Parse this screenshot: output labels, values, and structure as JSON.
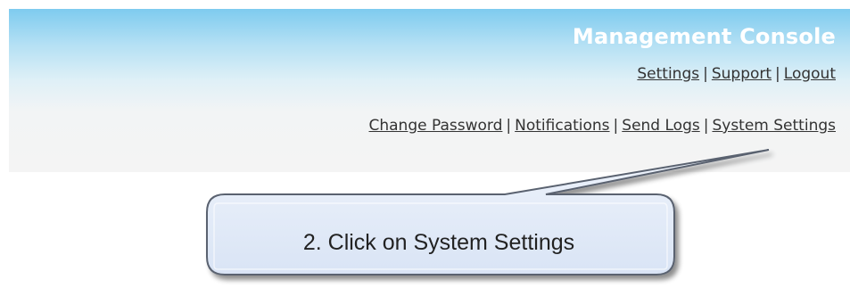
{
  "header": {
    "title": "Management Console",
    "top_links": [
      "Settings",
      "Support",
      "Logout"
    ],
    "sub_links": [
      "Change Password",
      "Notifications",
      "Send Logs",
      "System Settings"
    ],
    "separator": "|",
    "gradient_top_color": "#7ecbef",
    "background_color": "#f4f4f4"
  },
  "callout": {
    "text": "2. Click on System Settings",
    "fill_color": "#e2ebf8",
    "border_color": "#5a6270"
  }
}
